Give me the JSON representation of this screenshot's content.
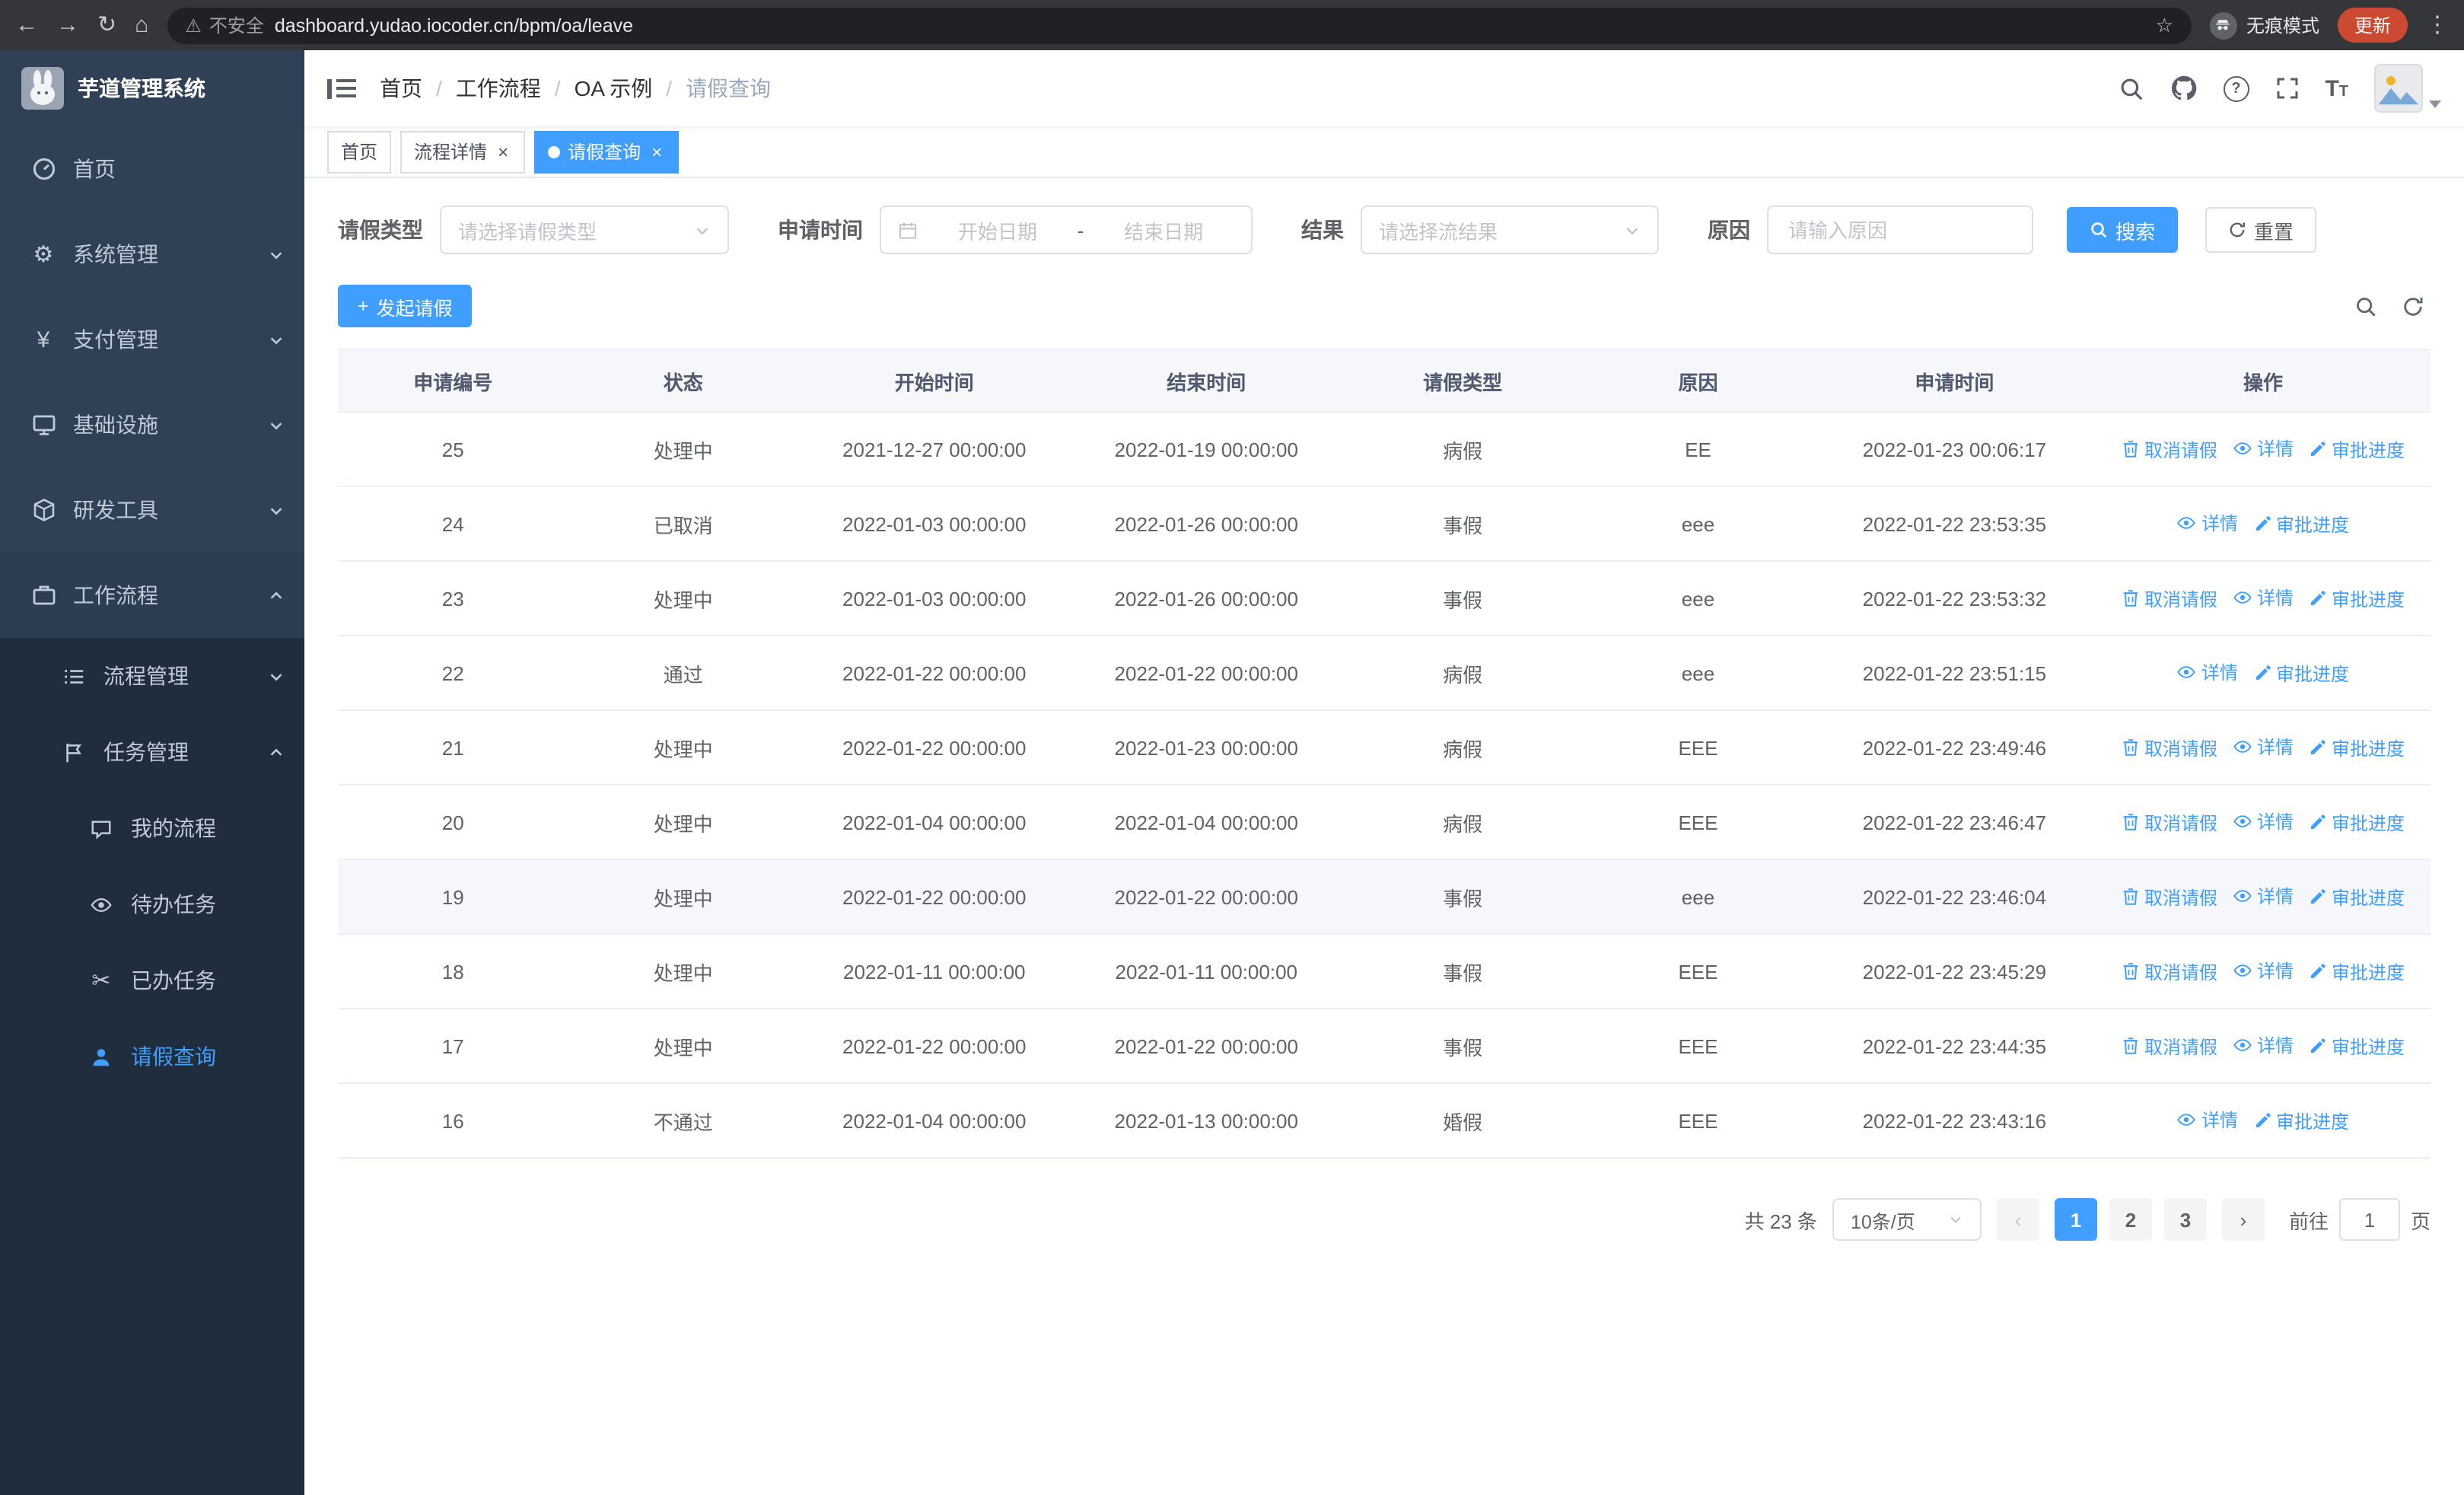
{
  "colors": {
    "accent": "#409eff",
    "sidebar": "#304156",
    "sidebar_dark": "#1f2d3d",
    "update_button": "#cc4a31"
  },
  "icons": {
    "back": "←",
    "forward": "→",
    "reload": "↻",
    "home": "⌂",
    "warning": "⚠",
    "star": "☆",
    "menu_dots": "⋮",
    "gear": "⚙",
    "yen": "¥",
    "scissors": "✂",
    "question": "?",
    "font_large": "T",
    "font_small": "T",
    "close": "×",
    "plus": "+",
    "prev": "‹",
    "next": "›"
  },
  "browser": {
    "security_warning": "不安全",
    "url": "dashboard.yudao.iocoder.cn/bpm/oa/leave",
    "incognito_label": "无痕模式",
    "update_button": "更新"
  },
  "sidebar": {
    "logo_title": "芋道管理系统",
    "items": [
      {
        "label": "首页"
      },
      {
        "label": "系统管理"
      },
      {
        "label": "支付管理"
      },
      {
        "label": "基础设施"
      },
      {
        "label": "研发工具"
      },
      {
        "label": "工作流程"
      }
    ],
    "workflow_children": [
      {
        "label": "流程管理"
      },
      {
        "label": "任务管理"
      }
    ],
    "task_children": [
      {
        "label": "我的流程"
      },
      {
        "label": "待办任务"
      },
      {
        "label": "已办任务"
      },
      {
        "label": "请假查询"
      }
    ]
  },
  "breadcrumb": [
    "首页",
    "工作流程",
    "OA 示例",
    "请假查询"
  ],
  "tags": [
    {
      "label": "首页"
    },
    {
      "label": "流程详情"
    },
    {
      "label": "请假查询"
    }
  ],
  "filters": {
    "leave_type_label": "请假类型",
    "leave_type_placeholder": "请选择请假类型",
    "apply_time_label": "申请时间",
    "date_start_placeholder": "开始日期",
    "date_separator": "-",
    "date_end_placeholder": "结束日期",
    "result_label": "结果",
    "result_placeholder": "请选择流结果",
    "reason_label": "原因",
    "reason_placeholder": "请输入原因",
    "search_button": "搜索",
    "reset_button": "重置"
  },
  "toolbar": {
    "create_button": "发起请假"
  },
  "table": {
    "columns": [
      "申请编号",
      "状态",
      "开始时间",
      "结束时间",
      "请假类型",
      "原因",
      "申请时间",
      "操作"
    ],
    "action_labels": {
      "cancel": "取消请假",
      "detail": "详情",
      "progress": "审批进度"
    },
    "rows": [
      {
        "id": "25",
        "status": "处理中",
        "start": "2021-12-27 00:00:00",
        "end": "2022-01-19 00:00:00",
        "type": "病假",
        "reason": "EE",
        "applyTime": "2022-01-23 00:06:17",
        "actions": [
          "cancel",
          "detail",
          "progress"
        ]
      },
      {
        "id": "24",
        "status": "已取消",
        "start": "2022-01-03 00:00:00",
        "end": "2022-01-26 00:00:00",
        "type": "事假",
        "reason": "eee",
        "applyTime": "2022-01-22 23:53:35",
        "actions": [
          "detail",
          "progress"
        ]
      },
      {
        "id": "23",
        "status": "处理中",
        "start": "2022-01-03 00:00:00",
        "end": "2022-01-26 00:00:00",
        "type": "事假",
        "reason": "eee",
        "applyTime": "2022-01-22 23:53:32",
        "actions": [
          "cancel",
          "detail",
          "progress"
        ]
      },
      {
        "id": "22",
        "status": "通过",
        "start": "2022-01-22 00:00:00",
        "end": "2022-01-22 00:00:00",
        "type": "病假",
        "reason": "eee",
        "applyTime": "2022-01-22 23:51:15",
        "actions": [
          "detail",
          "progress"
        ]
      },
      {
        "id": "21",
        "status": "处理中",
        "start": "2022-01-22 00:00:00",
        "end": "2022-01-23 00:00:00",
        "type": "病假",
        "reason": "EEE",
        "applyTime": "2022-01-22 23:49:46",
        "actions": [
          "cancel",
          "detail",
          "progress"
        ]
      },
      {
        "id": "20",
        "status": "处理中",
        "start": "2022-01-04 00:00:00",
        "end": "2022-01-04 00:00:00",
        "type": "病假",
        "reason": "EEE",
        "applyTime": "2022-01-22 23:46:47",
        "actions": [
          "cancel",
          "detail",
          "progress"
        ]
      },
      {
        "id": "19",
        "status": "处理中",
        "start": "2022-01-22 00:00:00",
        "end": "2022-01-22 00:00:00",
        "type": "事假",
        "reason": "eee",
        "applyTime": "2022-01-22 23:46:04",
        "actions": [
          "cancel",
          "detail",
          "progress"
        ],
        "highlighted": true
      },
      {
        "id": "18",
        "status": "处理中",
        "start": "2022-01-11 00:00:00",
        "end": "2022-01-11 00:00:00",
        "type": "事假",
        "reason": "EEE",
        "applyTime": "2022-01-22 23:45:29",
        "actions": [
          "cancel",
          "detail",
          "progress"
        ]
      },
      {
        "id": "17",
        "status": "处理中",
        "start": "2022-01-22 00:00:00",
        "end": "2022-01-22 00:00:00",
        "type": "事假",
        "reason": "EEE",
        "applyTime": "2022-01-22 23:44:35",
        "actions": [
          "cancel",
          "detail",
          "progress"
        ]
      },
      {
        "id": "16",
        "status": "不通过",
        "start": "2022-01-04 00:00:00",
        "end": "2022-01-13 00:00:00",
        "type": "婚假",
        "reason": "EEE",
        "applyTime": "2022-01-22 23:43:16",
        "actions": [
          "detail",
          "progress"
        ]
      }
    ]
  },
  "pagination": {
    "total": "共 23 条",
    "page_size": "10条/页",
    "pages": [
      "1",
      "2",
      "3"
    ],
    "active_page": "1",
    "goto_label": "前往",
    "goto_value": "1",
    "goto_suffix": "页"
  }
}
